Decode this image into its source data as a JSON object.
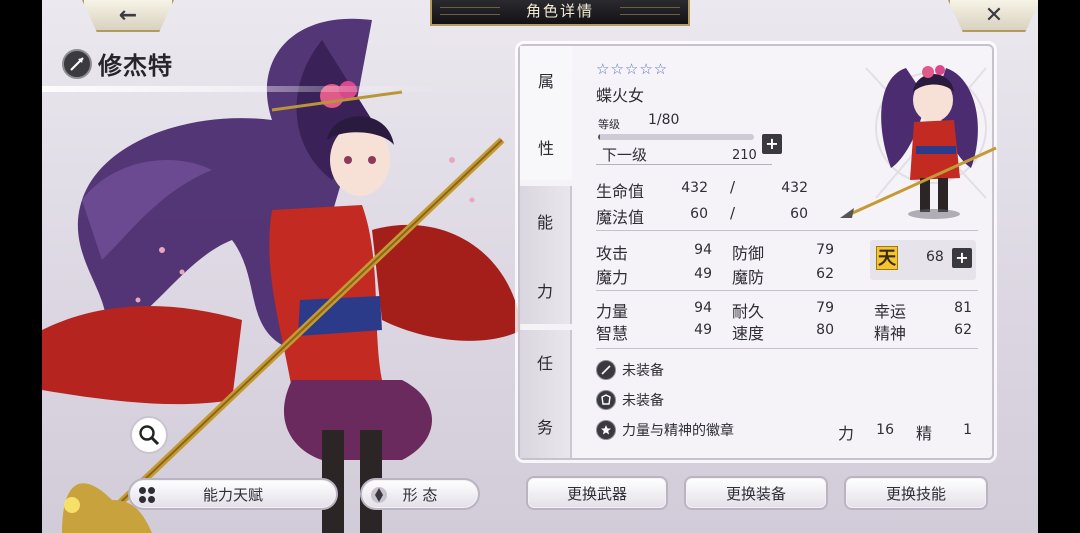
{
  "header": {
    "title": "角色详情",
    "back_icon": "back-arrow-icon",
    "close_icon": "close-x-icon"
  },
  "character": {
    "name": "修杰特",
    "class_icon": "spear-icon"
  },
  "tabs": [
    {
      "label_chars": [
        "属",
        "性"
      ],
      "active": true
    },
    {
      "label_chars": [
        "能",
        "力"
      ],
      "active": false
    },
    {
      "label_chars": [
        "任",
        "务"
      ],
      "active": false
    }
  ],
  "profile": {
    "stars": "☆☆☆☆☆",
    "star_count": 5,
    "class_name": "蝶火女",
    "level_label": "等级",
    "level_value": "1/80",
    "level_progress": 0.0125,
    "next_label": "下一级",
    "next_value": "210"
  },
  "vitals": {
    "hp_label": "生命值",
    "hp_current": "432",
    "hp_max": "432",
    "mp_label": "魔法值",
    "mp_current": "60",
    "mp_max": "60",
    "slash": "/"
  },
  "stats": {
    "atk_label": "攻击",
    "atk": "94",
    "def_label": "防御",
    "def": "79",
    "mag_label": "魔力",
    "mag": "49",
    "mdef_label": "魔防",
    "mdef": "62",
    "str_label": "力量",
    "str": "94",
    "end_label": "耐久",
    "end": "79",
    "luck_label": "幸运",
    "luck": "81",
    "int_label": "智慧",
    "int": "49",
    "spd_label": "速度",
    "spd": "80",
    "spirit_label": "精神",
    "spirit": "62"
  },
  "talent": {
    "icon_char": "天",
    "value": "68"
  },
  "equipment": {
    "weapon": "未装备",
    "armor": "未装备",
    "badge": "力量与精神的徽章",
    "badge_str_label": "力",
    "badge_str": "16",
    "badge_spirit_label": "精",
    "badge_spirit": "1"
  },
  "buttons": {
    "talent": "能力天赋",
    "form": "形 态",
    "change_weapon": "更换武器",
    "change_equip": "更换装备",
    "change_skill": "更换技能"
  },
  "colors": {
    "panel_bg": "#f6f4f8",
    "accent_gold": "#b59a5a",
    "star_blue": "#5a72c8",
    "robe_red": "#b5241e",
    "hair_purple": "#4a2a6e"
  }
}
